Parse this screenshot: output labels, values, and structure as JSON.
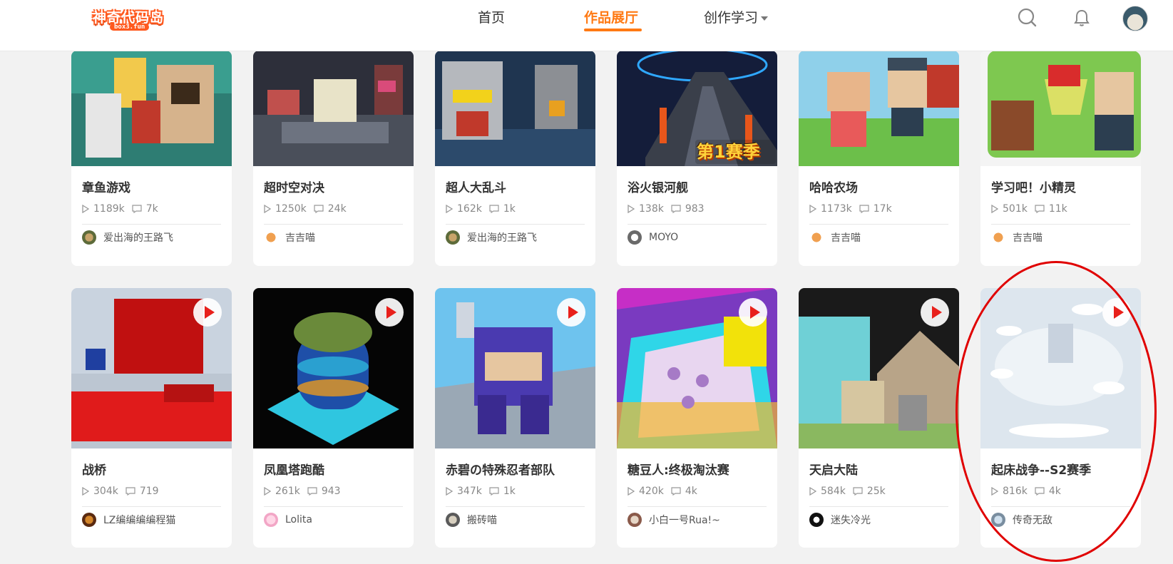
{
  "header": {
    "logo_text": "神奇代码岛",
    "logo_sub": "box3.fun",
    "nav": [
      {
        "label": "首页"
      },
      {
        "label": "作品展厅"
      },
      {
        "label": "创作学习"
      }
    ]
  },
  "row1": [
    {
      "title": "章鱼游戏",
      "plays": "1189k",
      "comments": "7k",
      "author": "爱出海的王路飞"
    },
    {
      "title": "超时空对决",
      "plays": "1250k",
      "comments": "24k",
      "author": "吉吉喵"
    },
    {
      "title": "超人大乱斗",
      "plays": "162k",
      "comments": "1k",
      "author": "爱出海的王路飞"
    },
    {
      "title": "浴火银河舰",
      "plays": "138k",
      "comments": "983",
      "author": "MOYO",
      "badge": "第1赛季"
    },
    {
      "title": "哈哈农场",
      "plays": "1173k",
      "comments": "17k",
      "author": "吉吉喵"
    },
    {
      "title": "学习吧！小精灵",
      "plays": "501k",
      "comments": "11k",
      "author": "吉吉喵"
    }
  ],
  "row2": [
    {
      "title": "战桥",
      "plays": "304k",
      "comments": "719",
      "author": "LZ编编编编程猫"
    },
    {
      "title": "凤凰塔跑酷",
      "plays": "261k",
      "comments": "943",
      "author": "Lolita"
    },
    {
      "title": "赤碧の特殊忍者部队",
      "plays": "347k",
      "comments": "1k",
      "author": "搬砖喵"
    },
    {
      "title": "糖豆人:终极淘汰赛",
      "plays": "420k",
      "comments": "4k",
      "author": "小白一号Rua!~"
    },
    {
      "title": "天启大陆",
      "plays": "584k",
      "comments": "25k",
      "author": "迷失冷光"
    },
    {
      "title": "起床战争--S2赛季",
      "plays": "816k",
      "comments": "4k",
      "author": "传奇无敌"
    }
  ]
}
